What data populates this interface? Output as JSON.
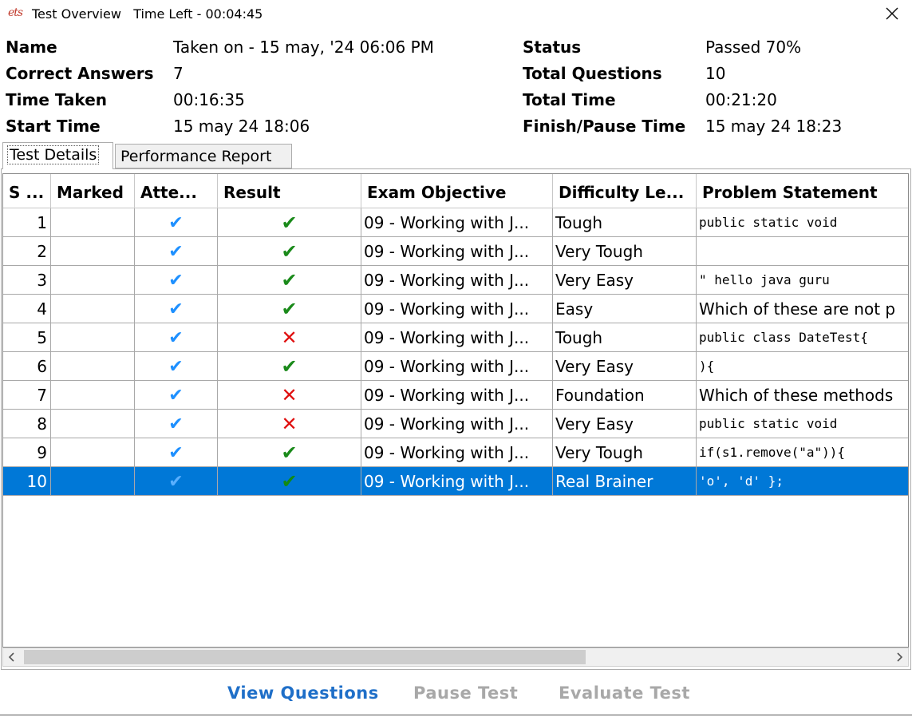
{
  "window": {
    "logo_text": "ets",
    "title": "Test Overview",
    "time_left": "Time Left - 00:04:45"
  },
  "summary": {
    "name_label": "Name",
    "name_value": "Taken on - 15 may, '24 06:06 PM",
    "correct_label": "Correct Answers",
    "correct_value": "7",
    "time_taken_label": "Time Taken",
    "time_taken_value": "00:16:35",
    "start_label": "Start Time",
    "start_value": "15 may 24 18:06",
    "status_label": "Status",
    "status_value": "Passed 70%",
    "total_q_label": "Total Questions",
    "total_q_value": "10",
    "total_time_label": "Total Time",
    "total_time_value": "00:21:20",
    "finish_label": "Finish/Pause Time",
    "finish_value": "15 may 24 18:23"
  },
  "tabs": [
    {
      "label": "Test Details",
      "active": true
    },
    {
      "label": "Performance Report",
      "active": false
    }
  ],
  "table": {
    "columns": [
      "S ...",
      "Marked",
      "Atte...",
      "Result",
      "Exam Objective",
      "Difficulty Le...",
      "Problem Statement"
    ],
    "rows": [
      {
        "sn": "1",
        "marked": "",
        "attempted": true,
        "result": "correct",
        "objective": "09 - Working with J...",
        "difficulty": "Tough",
        "problem": "public static void",
        "problem_code": true
      },
      {
        "sn": "2",
        "marked": "",
        "attempted": true,
        "result": "correct",
        "objective": "09 - Working with J...",
        "difficulty": "Very Tough",
        "problem": "",
        "problem_code": true
      },
      {
        "sn": "3",
        "marked": "",
        "attempted": true,
        "result": "correct",
        "objective": "09 - Working with J...",
        "difficulty": "Very Easy",
        "problem": "\"    hello java guru",
        "problem_code": true
      },
      {
        "sn": "4",
        "marked": "",
        "attempted": true,
        "result": "correct",
        "objective": "09 - Working with J...",
        "difficulty": "Easy",
        "problem": "Which of these are not p",
        "problem_code": false
      },
      {
        "sn": "5",
        "marked": "",
        "attempted": true,
        "result": "wrong",
        "objective": "09 - Working with J...",
        "difficulty": "Tough",
        "problem": "public class DateTest{",
        "problem_code": true
      },
      {
        "sn": "6",
        "marked": "",
        "attempted": true,
        "result": "correct",
        "objective": "09 - Working with J...",
        "difficulty": "Very Easy",
        "problem": "){",
        "problem_code": true
      },
      {
        "sn": "7",
        "marked": "",
        "attempted": true,
        "result": "wrong",
        "objective": "09 - Working with J...",
        "difficulty": "Foundation",
        "problem": "Which of these methods",
        "problem_code": false
      },
      {
        "sn": "8",
        "marked": "",
        "attempted": true,
        "result": "wrong",
        "objective": "09 - Working with J...",
        "difficulty": "Very Easy",
        "problem": "  public static void",
        "problem_code": true
      },
      {
        "sn": "9",
        "marked": "",
        "attempted": true,
        "result": "correct",
        "objective": "09 - Working with J...",
        "difficulty": "Very Tough",
        "problem": "if(s1.remove(\"a\")){",
        "problem_code": true
      },
      {
        "sn": "10",
        "marked": "",
        "attempted": true,
        "result": "correct",
        "objective": "09 - Working with J...",
        "difficulty": "Real Brainer",
        "problem": "'o', 'd' };",
        "problem_code": true,
        "selected": true
      }
    ]
  },
  "icons": {
    "attempted": "checkmark-icon",
    "correct": "green-check-icon",
    "wrong": "red-cross-icon",
    "close": "close-icon"
  },
  "colors": {
    "selection": "#0078d7",
    "correct": "#1a8a1a",
    "wrong": "#e01010",
    "attempted": "#1e90ff",
    "button_enabled": "#1f6fc8",
    "button_disabled": "#a8a8a8"
  },
  "buttons": {
    "view_questions": "View Questions",
    "pause_test": "Pause Test",
    "evaluate_test": "Evaluate Test"
  }
}
